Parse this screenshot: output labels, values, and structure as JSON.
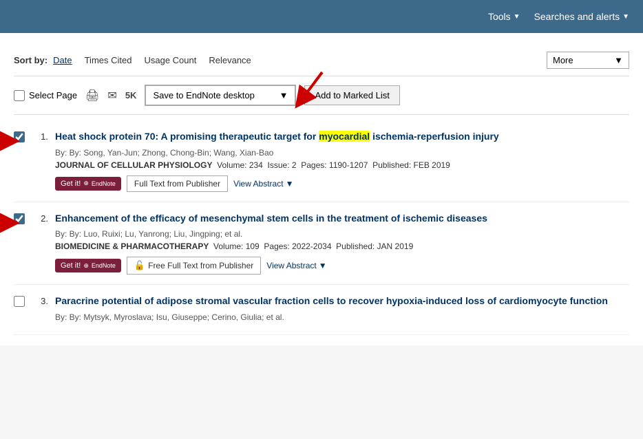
{
  "topbar": {
    "tools_label": "Tools",
    "searches_alerts_label": "Searches and alerts"
  },
  "sort_bar": {
    "sort_by_label": "Sort by:",
    "date_link": "Date",
    "times_cited": "Times Cited",
    "usage_count": "Usage Count",
    "relevance": "Relevance",
    "more_dropdown": "More"
  },
  "toolbar": {
    "select_page_label": "Select Page",
    "print_icon": "🖨",
    "email_icon": "✉",
    "export_label": "5K",
    "save_dropdown_label": "Save to EndNote desktop",
    "add_marked_label": "Add to Marked List"
  },
  "results": [
    {
      "number": "1.",
      "title_before": "Heat shock protein 70: A promising therapeutic target for ",
      "title_highlight": "myocardial",
      "title_after": " ischemia-reperfusion injury",
      "authors": "By: Song, Yan-Jun; Zhong, Chong-Bin; Wang, Xian-Bao",
      "journal": "JOURNAL OF CELLULAR PHYSIOLOGY",
      "volume": "Volume: 234",
      "issue": "Issue: 2",
      "pages": "Pages: 1190-1207",
      "published": "Published: FEB 2019",
      "get_it_label": "Get it!",
      "full_text_label": "Full Text from Publisher",
      "view_abstract_label": "View Abstract",
      "has_lock": false,
      "checked": true
    },
    {
      "number": "2.",
      "title_before": "Enhancement of the efficacy of mesenchymal stem cells in the treatment of ischemic diseases",
      "title_highlight": "",
      "title_after": "",
      "authors": "By: Luo, Ruixi; Lu, Yanrong; Liu, Jingping; et al.",
      "journal": "BIOMEDICINE & PHARMACOTHERAPY",
      "volume": "Volume: 109",
      "issue": "",
      "pages": "Pages: 2022-2034",
      "published": "Published: JAN 2019",
      "get_it_label": "Get it!",
      "full_text_label": "Free Full Text from Publisher",
      "view_abstract_label": "View Abstract",
      "has_lock": true,
      "checked": true
    },
    {
      "number": "3.",
      "title_before": "Paracrine potential of adipose stromal vascular fraction cells to recover hypoxia-induced loss of cardiomyocyte function",
      "title_highlight": "",
      "title_after": "",
      "authors": "By: Mytsyk, Myroslava; Isu, Giuseppe; Cerino, Giulia; et al.",
      "journal": "",
      "volume": "",
      "issue": "",
      "pages": "",
      "published": "",
      "get_it_label": "",
      "full_text_label": "",
      "view_abstract_label": "",
      "has_lock": false,
      "checked": false
    }
  ]
}
